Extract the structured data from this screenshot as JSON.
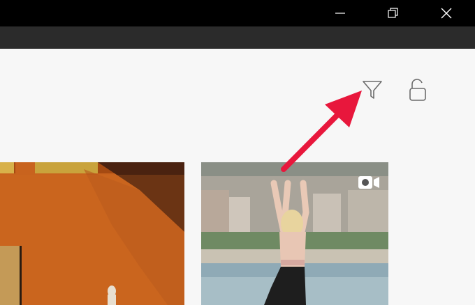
{
  "window": {
    "controls": [
      "minimize",
      "maximize",
      "close"
    ]
  },
  "toolbar": {
    "icons": [
      "filter-icon",
      "unlock-icon"
    ]
  },
  "media_grid": {
    "items": [
      {
        "kind": "photo",
        "subject": "orange-wall"
      },
      {
        "kind": "video",
        "subject": "yoga-beach"
      }
    ]
  },
  "annotation": {
    "arrow_color": "#e8173c"
  }
}
